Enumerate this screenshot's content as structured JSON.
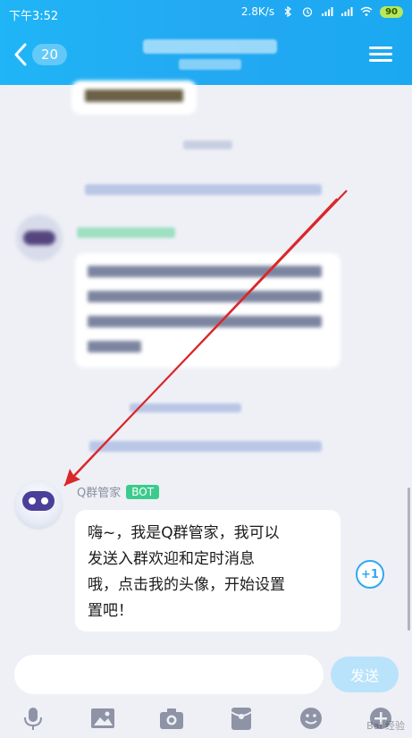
{
  "status_bar": {
    "time": "下午3:52",
    "speed": "2.8K/s",
    "battery": "90"
  },
  "header": {
    "unread_count": "20"
  },
  "message": {
    "sender_name": "Q群管家",
    "sender_badge": "BOT",
    "lines": [
      "嗨~，我是Q群管家，我可以",
      "发送入群欢迎和定时消息",
      "哦，点击我的头像，开始设置",
      "置吧！"
    ]
  },
  "side_action": {
    "label": "+1"
  },
  "composer": {
    "placeholder": "",
    "send_label": "发送"
  },
  "toolbar": {
    "items": [
      "voice",
      "image",
      "camera",
      "redpacket",
      "emoji",
      "more"
    ]
  },
  "colors": {
    "header_bg": "#1fb5f6",
    "accent": "#2ea8f2",
    "arrow": "#d9282a",
    "bot_badge": "#3ccb8c"
  },
  "watermark": "Bai 经验"
}
